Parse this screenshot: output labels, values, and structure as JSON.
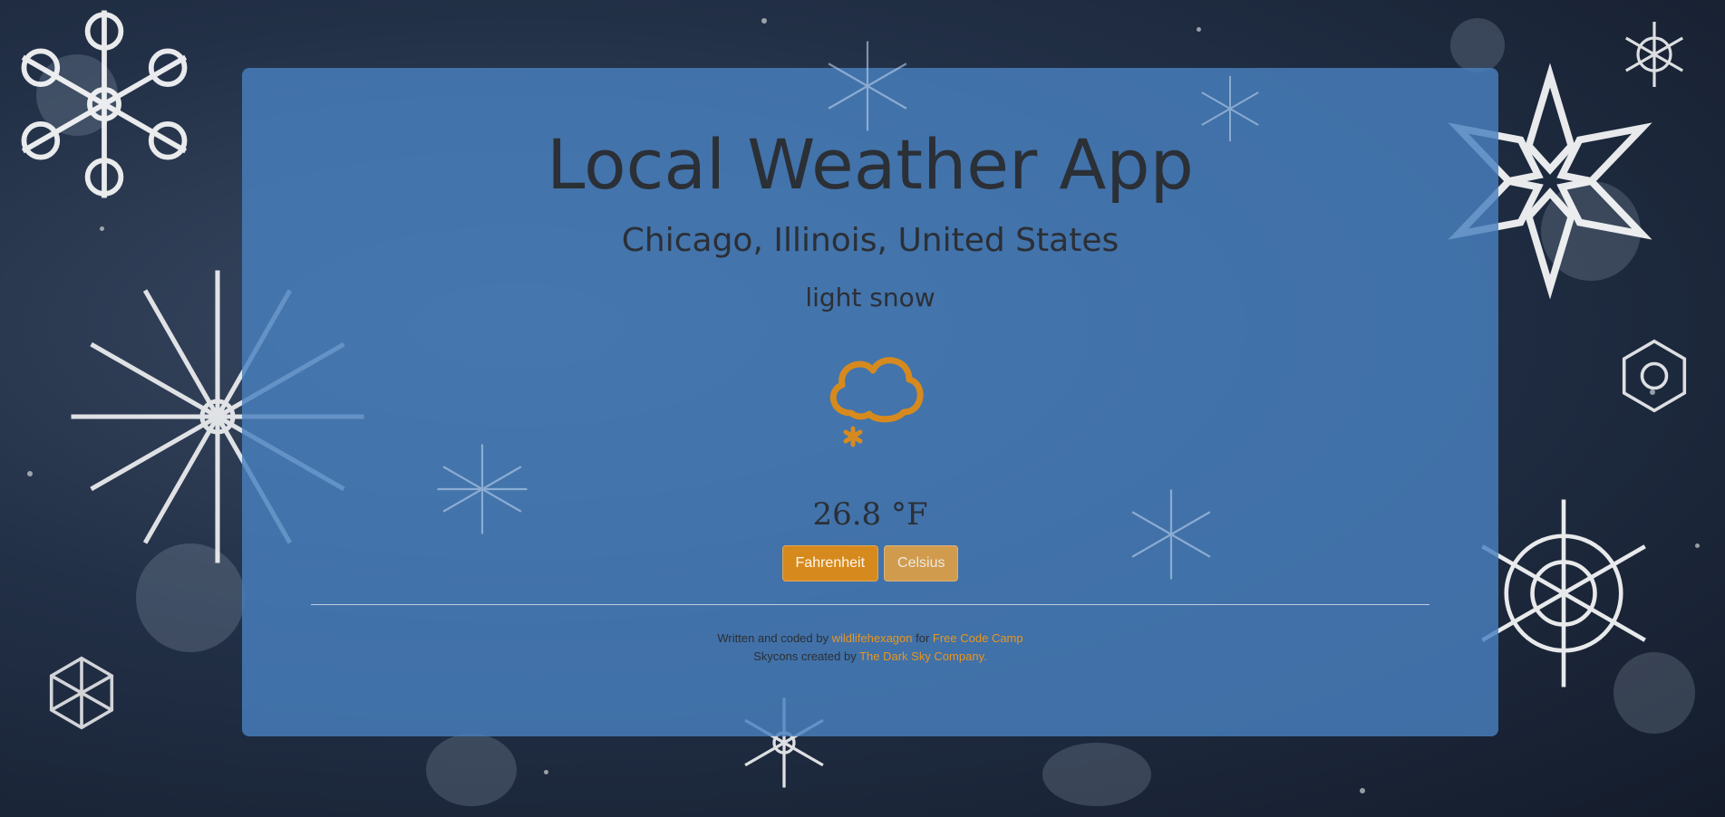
{
  "app": {
    "title": "Local Weather App",
    "location": "Chicago, Illinois, United States",
    "condition": "light snow",
    "condition_icon": "snow-cloud-icon",
    "temperature": "26.8 °F"
  },
  "units": {
    "fahrenheit_label": "Fahrenheit",
    "celsius_label": "Celsius"
  },
  "footer": {
    "line1_prefix": "Written and coded by ",
    "author_link": "wildlifehexagon",
    "line1_mid": " for ",
    "fcc_link": "Free Code Camp",
    "line2_prefix": "Skycons created by ",
    "darksky_link": "The Dark Sky Company",
    "line2_suffix": "."
  },
  "colors": {
    "panel": "#4880be",
    "accent": "#d68a1e",
    "text": "#2b2f36",
    "link": "#e8961f"
  }
}
